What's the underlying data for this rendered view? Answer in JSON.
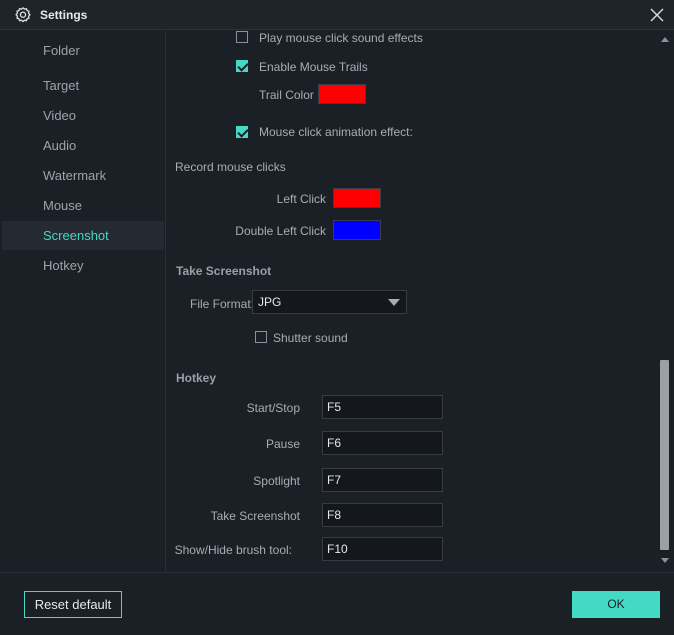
{
  "window": {
    "title": "Settings"
  },
  "sidebar": {
    "items": [
      {
        "label": "Folder"
      },
      {
        "label": "Target"
      },
      {
        "label": "Video"
      },
      {
        "label": "Audio"
      },
      {
        "label": "Watermark"
      },
      {
        "label": "Mouse"
      },
      {
        "label": "Screenshot",
        "active": true
      },
      {
        "label": "Hotkey"
      }
    ]
  },
  "mouse": {
    "play_click_sound": {
      "label": "Play mouse click sound effects",
      "checked": false
    },
    "enable_trails": {
      "label": "Enable Mouse Trails",
      "checked": true
    },
    "trail_color": {
      "label": "Trail Color",
      "color": "#ff0000"
    },
    "click_animation": {
      "label": "Mouse click animation effect:",
      "checked": true
    },
    "record_clicks_label": "Record mouse clicks",
    "left_click": {
      "label": "Left Click",
      "color": "#ff0000"
    },
    "double_left_click": {
      "label": "Double Left Click",
      "color": "#0000ff"
    }
  },
  "screenshot": {
    "section_title": "Take Screenshot",
    "file_format_label": "File Format:",
    "file_format_value": "JPG",
    "shutter_sound": {
      "label": "Shutter sound",
      "checked": false
    }
  },
  "hotkey": {
    "section_title": "Hotkey",
    "rows": [
      {
        "label": "Start/Stop",
        "value": "F5"
      },
      {
        "label": "Pause",
        "value": "F6"
      },
      {
        "label": "Spotlight",
        "value": "F7"
      },
      {
        "label": "Take Screenshot",
        "value": "F8"
      },
      {
        "label": "Show/Hide brush tool:",
        "value": "F10"
      }
    ]
  },
  "footer": {
    "reset_label": "Reset default",
    "ok_label": "OK"
  },
  "colors": {
    "accent": "#43d9c3",
    "background": "#1b1f26"
  }
}
